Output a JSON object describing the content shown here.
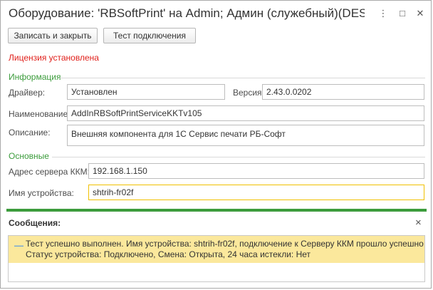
{
  "window": {
    "title": "Оборудование: 'RBSoftPrint' на Admin; Админ (служебный)(DES...",
    "controls": {
      "more": "⋮",
      "maximize": "□",
      "close": "✕"
    }
  },
  "toolbar": {
    "save_close_label": "Записать и закрыть",
    "test_connection_label": "Тест подключения"
  },
  "license_status": "Лицензия установлена",
  "info_group": {
    "title": "Информация",
    "driver_label": "Драйвер:",
    "driver_value": "Установлен",
    "version_label": "Версия:",
    "version_value": "2.43.0.0202",
    "name_label": "Наименование:",
    "name_value": "AddInRBSoftPrintServiceKKTv105",
    "description_label": "Описание:",
    "description_value": "Внешняя компонента для 1С Сервис печати РБ-Софт"
  },
  "main_group": {
    "title": "Основные",
    "server_label": "Адрес сервера ККМ:",
    "server_value": "192.168.1.150",
    "device_label": "Имя устройства:",
    "device_value": "shtrih-fr02f"
  },
  "messages": {
    "header": "Сообщения:",
    "close": "×",
    "marker": "—",
    "line1": "Тест успешно выполнен. Имя устройства: shtrih-fr02f, подключение к Серверу ККМ прошло успешно",
    "line2": "Статус устройства: Подключено, Смена: Открыта, 24 часа истекли: Нет"
  },
  "colors": {
    "license": "#e0201b",
    "group_title": "#3c9c3c",
    "active_field_border": "#f0c000",
    "message_background": "#fbe89c"
  }
}
